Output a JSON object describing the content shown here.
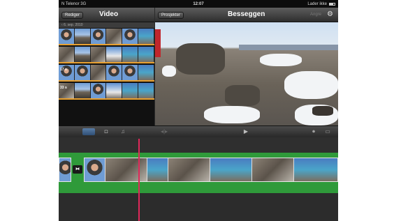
{
  "status": {
    "carrier": "N Telenor",
    "network": "3G",
    "time": "12:07",
    "charging": "Lader ikke"
  },
  "left_header": {
    "edit_button": "Rediger",
    "title": "Video"
  },
  "right_header": {
    "projects_button": "Prosjekter",
    "title": "Besseggen",
    "undo_button": "Angre",
    "settings_icon": "gear-icon"
  },
  "media": {
    "date_group": "6. sep. 2010",
    "strips": [
      {
        "label": ""
      },
      {
        "label": ""
      },
      {
        "label": "17 s"
      },
      {
        "label": "33 s"
      }
    ]
  },
  "toolbar": {
    "tabs": [
      {
        "icon": "video-filmstrip-icon"
      },
      {
        "icon": "camera-icon"
      },
      {
        "icon": "music-note-icon"
      }
    ],
    "buttons": [
      {
        "icon": "audio-levels-icon"
      },
      {
        "icon": "play-icon"
      },
      {
        "icon": "microphone-icon"
      },
      {
        "icon": "record-camera-icon"
      }
    ]
  },
  "colors": {
    "accent_orange": "#e8a030",
    "timeline_green": "#2f9a3a",
    "playhead": "#e0285a"
  }
}
